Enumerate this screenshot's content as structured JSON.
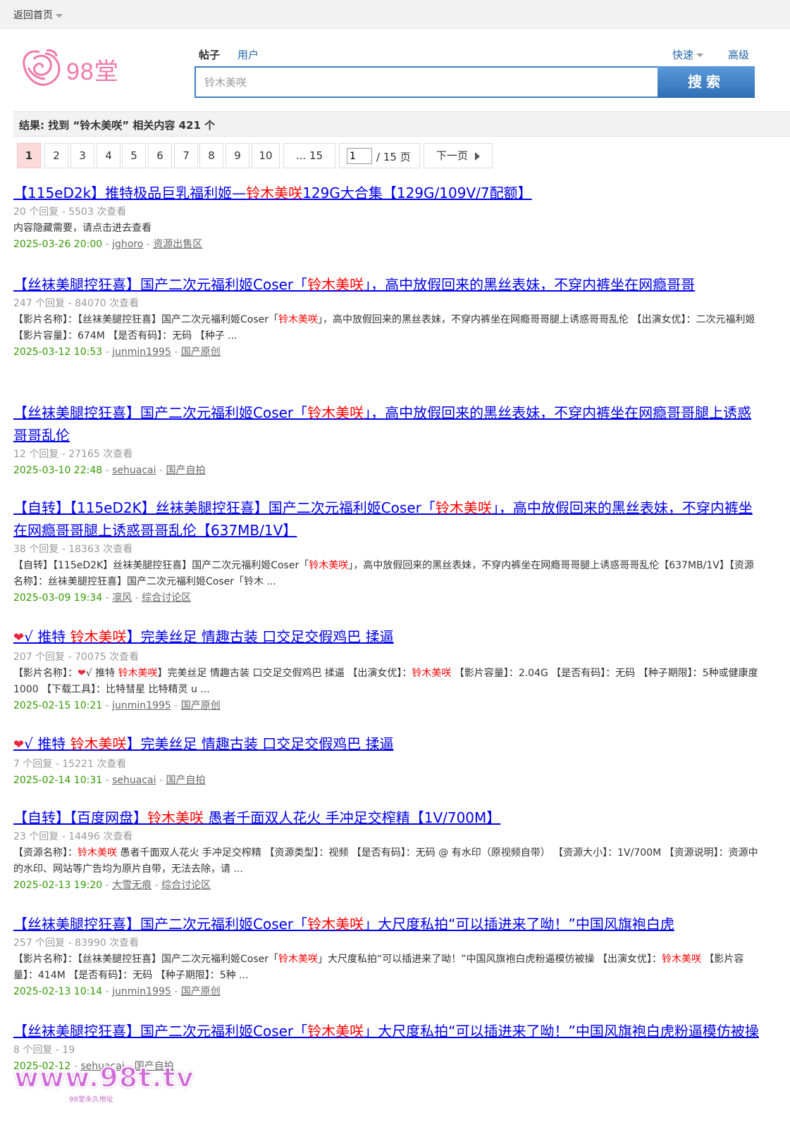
{
  "topbar": {
    "back_label": "返回首页"
  },
  "brand": {
    "logo_text": "98堂"
  },
  "search": {
    "tab_posts": "帖子",
    "tab_users": "用户",
    "quick_label": "快速",
    "advanced_label": "高级",
    "input_value": "铃木美咲",
    "button_label": "搜索"
  },
  "result_summary": "结果: 找到 “铃木美咲” 相关内容 421 个",
  "pagination": {
    "pages": [
      "1",
      "2",
      "3",
      "4",
      "5",
      "6",
      "7",
      "8",
      "9",
      "10",
      "... 15"
    ],
    "current": "1",
    "input_value": "1",
    "total_label": "/ 15 页",
    "next_label": "下一页"
  },
  "results": [
    {
      "title_parts": [
        {
          "t": "【115eD2k】推特极品巨乳福利姬—",
          "hl": false
        },
        {
          "t": "铃木美咲",
          "hl": true
        },
        {
          "t": "129G大合集【129G/109V/7配额】",
          "hl": false
        }
      ],
      "stats": "20 个回复 - 5503 次查看",
      "desc_parts": [
        {
          "t": "内容隐藏需要，请点击进去查看",
          "hl": false
        }
      ],
      "date": "2025-03-26 20:00",
      "author": "jghoro",
      "forum": "资源出售区"
    },
    {
      "title_parts": [
        {
          "t": "【丝袜美腿控狂喜】国产二次元福利姬Coser「",
          "hl": false
        },
        {
          "t": "铃木美咲",
          "hl": true
        },
        {
          "t": "」，高中放假回来的黑丝表妹，不穿内裤坐在网瘾哥哥",
          "hl": false
        }
      ],
      "stats": "247 个回复 - 84070 次查看",
      "desc_parts": [
        {
          "t": "【影片名称】：【丝袜美腿控狂喜】国产二次元福利姬Coser「",
          "hl": false
        },
        {
          "t": "铃木美咲",
          "hl": true
        },
        {
          "t": "」，高中放假回来的黑丝表妹，不穿内裤坐在网瘾哥哥腿上诱惑哥哥乱伦 【出演女优】：二次元福利姬 【影片容量】：674M 【是否有码】：无码 【种子 ...",
          "hl": false
        }
      ],
      "date": "2025-03-12 10:53",
      "author": "junmin1995",
      "forum": "国产原创"
    },
    {
      "title_parts": [
        {
          "t": "【丝袜美腿控狂喜】国产二次元福利姬Coser「",
          "hl": false
        },
        {
          "t": "铃木美咲",
          "hl": true
        },
        {
          "t": "」，高中放假回来的黑丝表妹，不穿内裤坐在网瘾哥哥腿上诱惑哥哥乱伦",
          "hl": false
        }
      ],
      "stats": "12 个回复 - 27165 次查看",
      "desc_parts": [],
      "date": "2025-03-10 22:48",
      "author": "sehuacai",
      "forum": "国产自拍"
    },
    {
      "title_parts": [
        {
          "t": "【自转】【115eD2K】丝袜美腿控狂喜】国产二次元福利姬Coser「",
          "hl": false
        },
        {
          "t": "铃木美咲",
          "hl": true
        },
        {
          "t": "」，高中放假回来的黑丝表妹，不穿内裤坐在网瘾哥哥腿上诱惑哥哥乱伦【637MB/1V】",
          "hl": false
        }
      ],
      "stats": "38 个回复 - 18363 次查看",
      "desc_parts": [
        {
          "t": "【自转】【115eD2K】丝袜美腿控狂喜】国产二次元福利姬Coser「",
          "hl": false
        },
        {
          "t": "铃木美咲",
          "hl": true
        },
        {
          "t": "」，高中放假回来的黑丝表妹，不穿内裤坐在网瘾哥哥腿上诱惑哥哥乱伦【637MB/1V】【资源名称】：丝袜美腿控狂喜】国产二次元福利姬Coser「铃木 ...",
          "hl": false
        }
      ],
      "date": "2025-03-09 19:34",
      "author": "凛风",
      "forum": "综合讨论区"
    },
    {
      "title_parts": [
        {
          "t": "❤",
          "hl": false,
          "heart": true
        },
        {
          "t": "√ 推特 ",
          "hl": false
        },
        {
          "t": "铃木美咲",
          "hl": true
        },
        {
          "t": "】完美丝足 情趣古装 口交足交假鸡巴 揉逼",
          "hl": false
        }
      ],
      "stats": "207 个回复 - 70075 次查看",
      "desc_parts": [
        {
          "t": "【影片名称】：",
          "hl": false
        },
        {
          "t": "❤",
          "hl": false,
          "heart": true
        },
        {
          "t": "√ 推特 ",
          "hl": false
        },
        {
          "t": "铃木美咲",
          "hl": true
        },
        {
          "t": "】完美丝足 情趣古装 口交足交假鸡巴 揉逼 【出演女优】：",
          "hl": false
        },
        {
          "t": "铃木美咲",
          "hl": true
        },
        {
          "t": " 【影片容量】：2.04G 【是否有码】：无码 【种子期限】：5种或健康度1000 【下载工具】：比特彗星 比特精灵 u ...",
          "hl": false
        }
      ],
      "date": "2025-02-15 10:21",
      "author": "junmin1995",
      "forum": "国产原创"
    },
    {
      "title_parts": [
        {
          "t": "❤",
          "hl": false,
          "heart": true
        },
        {
          "t": "√ 推特 ",
          "hl": false
        },
        {
          "t": "铃木美咲",
          "hl": true
        },
        {
          "t": "】完美丝足 情趣古装 口交足交假鸡巴 揉逼",
          "hl": false
        }
      ],
      "stats": "7 个回复 - 15221 次查看",
      "desc_parts": [],
      "date": "2025-02-14 10:31",
      "author": "sehuacai",
      "forum": "国产自拍"
    },
    {
      "title_parts": [
        {
          "t": "【自转】【百度网盘】",
          "hl": false
        },
        {
          "t": "铃木美咲",
          "hl": true
        },
        {
          "t": " 愚者千面双人花火 手冲足交榨精【1V/700M】",
          "hl": false
        }
      ],
      "stats": "23 个回复 - 14496 次查看",
      "desc_parts": [
        {
          "t": "【资源名称】：",
          "hl": false
        },
        {
          "t": "铃木美咲",
          "hl": true
        },
        {
          "t": " 愚者千面双人花火 手冲足交榨精 【资源类型】：视频 【是否有码】：无码 @ 有水印（原视频自带） 【资源大小】：1V/700M 【资源说明】：资源中的水印、网站等广告均为原片自带，无法去除，请 ...",
          "hl": false
        }
      ],
      "date": "2025-02-13 19:20",
      "author": "大雪无痕",
      "forum": "综合讨论区"
    },
    {
      "title_parts": [
        {
          "t": "【丝袜美腿控狂喜】国产二次元福利姬Coser「",
          "hl": false
        },
        {
          "t": "铃木美咲",
          "hl": true
        },
        {
          "t": "」大尺度私拍“可以插进来了呦！”中国风旗袍白虎",
          "hl": false
        }
      ],
      "stats": "257 个回复 - 83990 次查看",
      "desc_parts": [
        {
          "t": "【影片名称】：【丝袜美腿控狂喜】国产二次元福利姬Coser「",
          "hl": false
        },
        {
          "t": "铃木美咲",
          "hl": true
        },
        {
          "t": "」大尺度私拍“可以插进来了呦！”中国风旗袍白虎粉逼模仿被操 【出演女优】：",
          "hl": false
        },
        {
          "t": "铃木美咲",
          "hl": true
        },
        {
          "t": " 【影片容量】：414M 【是否有码】：无码 【种子期限】：5种 ...",
          "hl": false
        }
      ],
      "date": "2025-02-13 10:14",
      "author": "junmin1995",
      "forum": "国产原创"
    },
    {
      "title_parts": [
        {
          "t": "【丝袜美腿控狂喜】国产二次元福利姬Coser「",
          "hl": false
        },
        {
          "t": "铃木美咲",
          "hl": true
        },
        {
          "t": "」大尺度私拍“可以插进来了呦！”中国风旗袍白虎粉逼模仿被操",
          "hl": false
        }
      ],
      "stats": "8 个回复 - 19",
      "desc_parts": [],
      "date": "2025-02-12",
      "author": "sehuacai",
      "forum": "国产自拍"
    }
  ],
  "watermark": {
    "text": "www.98t.tv",
    "sub": "98堂永久地址"
  }
}
